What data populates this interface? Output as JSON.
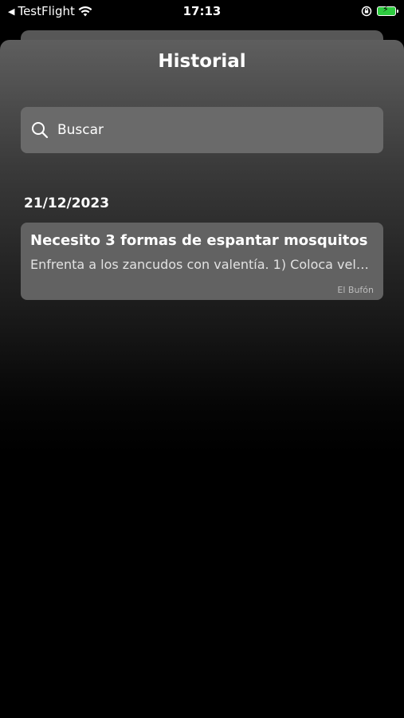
{
  "status_bar": {
    "back_app": "TestFlight",
    "time": "17:13"
  },
  "sheet": {
    "title": "Historial"
  },
  "search": {
    "placeholder": "Buscar"
  },
  "history": {
    "groups": [
      {
        "date": "21/12/2023",
        "items": [
          {
            "title": "Necesito 3 formas de espantar mosquitos",
            "preview": "Enfrenta a los zancudos con valentía. 1) Coloca velas...",
            "author": "El Bufón"
          }
        ]
      }
    ]
  },
  "colors": {
    "battery": "#2ecc40",
    "card": "#626262",
    "search_bg": "#6a6a6a"
  }
}
